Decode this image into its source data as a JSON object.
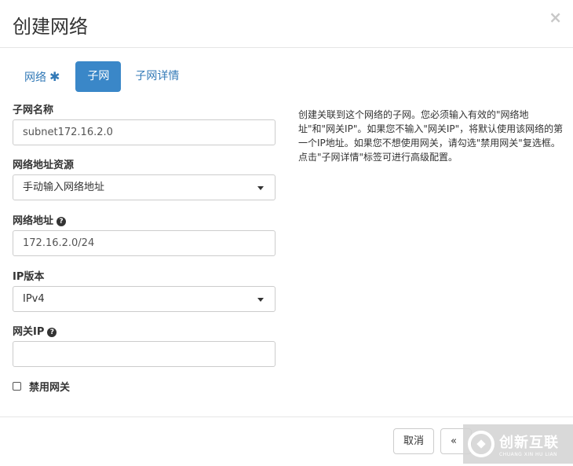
{
  "dialog": {
    "title": "创建网络",
    "close": "×"
  },
  "tabs": [
    {
      "label": "网络",
      "required_mark": "✱"
    },
    {
      "label": "子网"
    },
    {
      "label": "子网详情"
    }
  ],
  "form": {
    "subnet_name": {
      "label": "子网名称",
      "value": "subnet172.16.2.0"
    },
    "address_source": {
      "label": "网络地址资源",
      "value": "手动输入网络地址"
    },
    "network_address": {
      "label": "网络地址",
      "value": "172.16.2.0/24",
      "help": "?"
    },
    "ip_version": {
      "label": "IP版本",
      "value": "IPv4"
    },
    "gateway_ip": {
      "label": "网关IP",
      "value": "",
      "help": "?"
    },
    "disable_gateway": {
      "label": "禁用网关",
      "checked": false
    }
  },
  "description": "创建关联到这个网络的子网。您必须输入有效的\"网络地址\"和\"网关IP\"。如果您不输入\"网关IP\"，将默认使用该网络的第一个IP地址。如果您不想使用网关，请勾选\"禁用网关\"复选框。点击\"子网详情\"标签可进行高级配置。",
  "footer": {
    "cancel_label": "取消",
    "back_label": "«"
  },
  "watermark": {
    "name": "创新互联",
    "sub": "CHUANG XIN HU LIAN"
  }
}
